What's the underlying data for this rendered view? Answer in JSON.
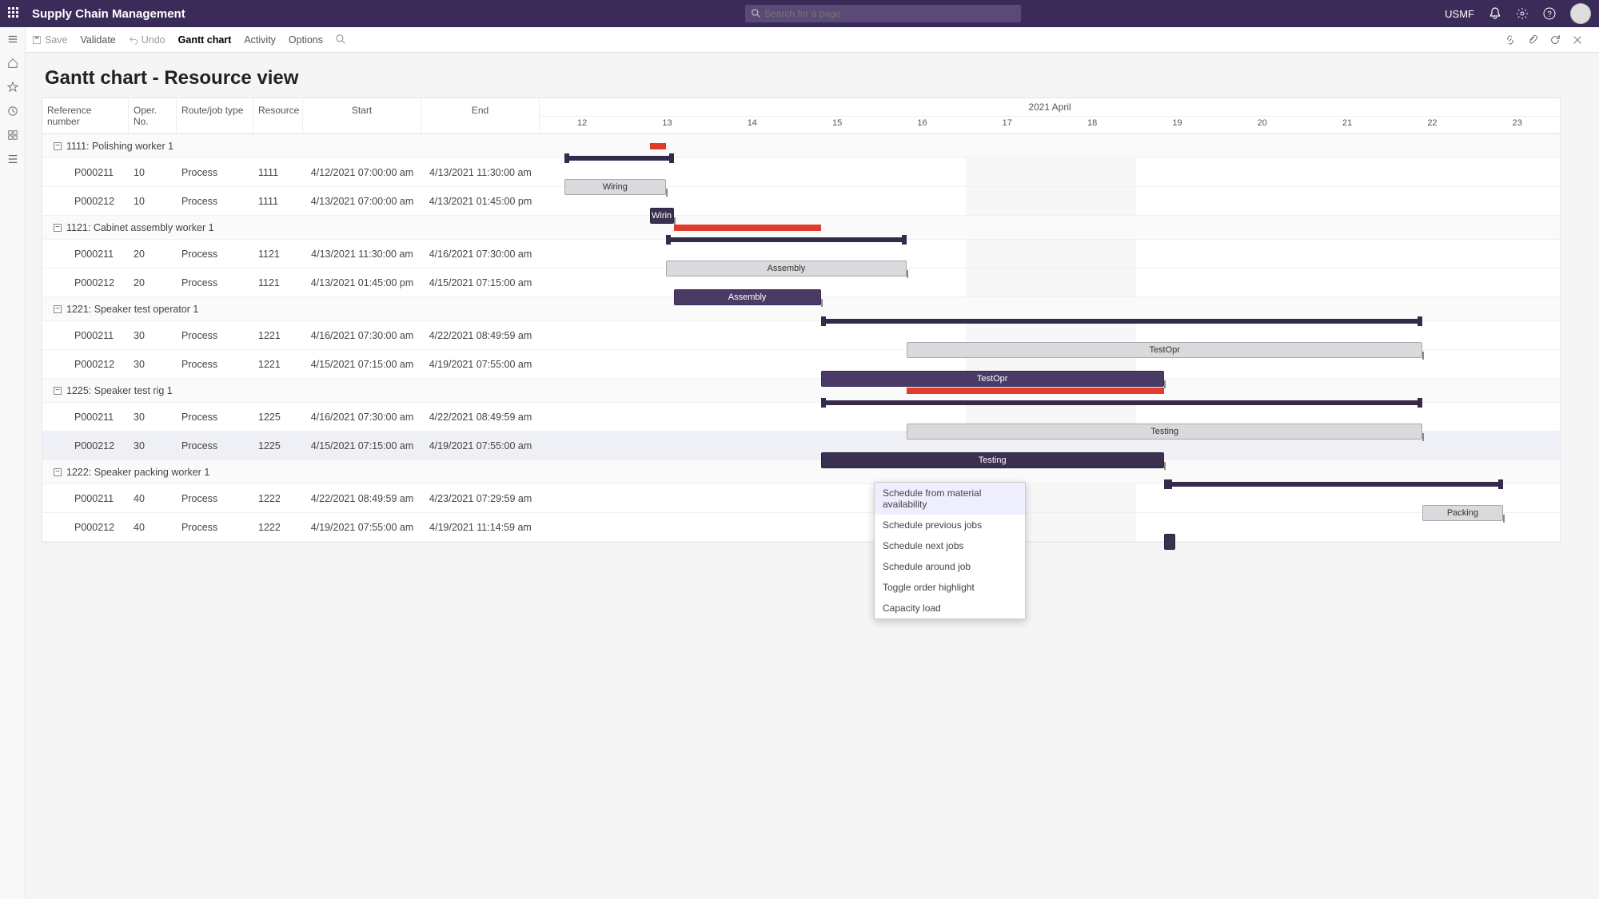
{
  "header": {
    "app_title": "Supply Chain Management",
    "search_placeholder": "Search for a page",
    "company": "USMF"
  },
  "actionbar": {
    "save": "Save",
    "validate": "Validate",
    "undo": "Undo",
    "tab_gantt": "Gantt chart",
    "tab_activity": "Activity",
    "tab_options": "Options"
  },
  "page_title": "Gantt chart - Resource view",
  "columns": {
    "ref": "Reference number",
    "op": "Oper. No.",
    "type": "Route/job type",
    "res": "Resource",
    "start": "Start",
    "end": "End"
  },
  "timeline": {
    "month": "2021 April",
    "days": [
      "12",
      "13",
      "14",
      "15",
      "16",
      "17",
      "18",
      "19",
      "20",
      "21",
      "22",
      "23"
    ]
  },
  "groups": [
    {
      "id": "g1",
      "label": "1111: Polishing worker 1"
    },
    {
      "id": "g2",
      "label": "1121: Cabinet assembly worker 1"
    },
    {
      "id": "g3",
      "label": "1221: Speaker test operator 1"
    },
    {
      "id": "g4",
      "label": "1225: Speaker test rig 1"
    },
    {
      "id": "g5",
      "label": "1222: Speaker packing worker 1"
    }
  ],
  "rows": [
    {
      "grp": 0,
      "ref": "P000211",
      "op": "10",
      "type": "Process",
      "res": "1111",
      "start": "4/12/2021 07:00:00 am",
      "end": "4/13/2021 11:30:00 am"
    },
    {
      "grp": 0,
      "ref": "P000212",
      "op": "10",
      "type": "Process",
      "res": "1111",
      "start": "4/13/2021 07:00:00 am",
      "end": "4/13/2021 01:45:00 pm"
    },
    {
      "grp": 1,
      "ref": "P000211",
      "op": "20",
      "type": "Process",
      "res": "1121",
      "start": "4/13/2021 11:30:00 am",
      "end": "4/16/2021 07:30:00 am"
    },
    {
      "grp": 1,
      "ref": "P000212",
      "op": "20",
      "type": "Process",
      "res": "1121",
      "start": "4/13/2021 01:45:00 pm",
      "end": "4/15/2021 07:15:00 am"
    },
    {
      "grp": 2,
      "ref": "P000211",
      "op": "30",
      "type": "Process",
      "res": "1221",
      "start": "4/16/2021 07:30:00 am",
      "end": "4/22/2021 08:49:59 am"
    },
    {
      "grp": 2,
      "ref": "P000212",
      "op": "30",
      "type": "Process",
      "res": "1221",
      "start": "4/15/2021 07:15:00 am",
      "end": "4/19/2021 07:55:00 am"
    },
    {
      "grp": 3,
      "ref": "P000211",
      "op": "30",
      "type": "Process",
      "res": "1225",
      "start": "4/16/2021 07:30:00 am",
      "end": "4/22/2021 08:49:59 am"
    },
    {
      "grp": 3,
      "ref": "P000212",
      "op": "30",
      "type": "Process",
      "res": "1225",
      "start": "4/15/2021 07:15:00 am",
      "end": "4/19/2021 07:55:00 am",
      "sel": true
    },
    {
      "grp": 4,
      "ref": "P000211",
      "op": "40",
      "type": "Process",
      "res": "1222",
      "start": "4/22/2021 08:49:59 am",
      "end": "4/23/2021 07:29:59 am"
    },
    {
      "grp": 4,
      "ref": "P000212",
      "op": "40",
      "type": "Process",
      "res": "1222",
      "start": "4/19/2021 07:55:00 am",
      "end": "4/19/2021 11:14:59 am"
    }
  ],
  "bars": {
    "wiring1": "Wiring",
    "wiring2": "Wirin",
    "assembly1": "Assembly",
    "assembly2": "Assembly",
    "testopr1": "TestOpr",
    "testopr2": "TestOpr",
    "testing1": "Testing",
    "testing2": "Testing",
    "packing": "Packing"
  },
  "context_menu": {
    "items": [
      "Schedule from material availability",
      "Schedule previous jobs",
      "Schedule next jobs",
      "Schedule around job",
      "Toggle order highlight",
      "Capacity load"
    ]
  },
  "chart_data": {
    "type": "gantt",
    "x_axis": {
      "unit": "day",
      "start": "2021-04-12",
      "end": "2021-04-23"
    },
    "resources": [
      {
        "id": "1111",
        "name": "Polishing worker 1"
      },
      {
        "id": "1121",
        "name": "Cabinet assembly worker 1"
      },
      {
        "id": "1221",
        "name": "Speaker test operator 1"
      },
      {
        "id": "1225",
        "name": "Speaker test rig 1"
      },
      {
        "id": "1222",
        "name": "Speaker packing worker 1"
      }
    ],
    "tasks": [
      {
        "ref": "P000211",
        "op": 10,
        "res": "1111",
        "label": "Wiring",
        "start": "2021-04-12T07:00",
        "end": "2021-04-13T11:30",
        "style": "light"
      },
      {
        "ref": "P000212",
        "op": 10,
        "res": "1111",
        "label": "Wiring",
        "start": "2021-04-13T07:00",
        "end": "2021-04-13T13:45",
        "style": "dark"
      },
      {
        "ref": "P000211",
        "op": 20,
        "res": "1121",
        "label": "Assembly",
        "start": "2021-04-13T11:30",
        "end": "2021-04-16T07:30",
        "style": "light"
      },
      {
        "ref": "P000212",
        "op": 20,
        "res": "1121",
        "label": "Assembly",
        "start": "2021-04-13T13:45",
        "end": "2021-04-15T07:15",
        "style": "dark"
      },
      {
        "ref": "P000211",
        "op": 30,
        "res": "1221",
        "label": "TestOpr",
        "start": "2021-04-16T07:30",
        "end": "2021-04-22T08:50",
        "style": "light"
      },
      {
        "ref": "P000212",
        "op": 30,
        "res": "1221",
        "label": "TestOpr",
        "start": "2021-04-15T07:15",
        "end": "2021-04-19T07:55",
        "style": "dark"
      },
      {
        "ref": "P000211",
        "op": 30,
        "res": "1225",
        "label": "Testing",
        "start": "2021-04-16T07:30",
        "end": "2021-04-22T08:50",
        "style": "light"
      },
      {
        "ref": "P000212",
        "op": 30,
        "res": "1225",
        "label": "Testing",
        "start": "2021-04-15T07:15",
        "end": "2021-04-19T07:55",
        "style": "dark",
        "selected": true
      },
      {
        "ref": "P000211",
        "op": 40,
        "res": "1222",
        "label": "Packing",
        "start": "2021-04-22T08:50",
        "end": "2021-04-23T07:30",
        "style": "light"
      },
      {
        "ref": "P000212",
        "op": 40,
        "res": "1222",
        "label": "Packing",
        "start": "2021-04-19T07:55",
        "end": "2021-04-19T11:15",
        "style": "dark"
      }
    ],
    "overload_segments": [
      {
        "res": "1111",
        "start": "2021-04-13T07:00",
        "end": "2021-04-13T11:30"
      },
      {
        "res": "1121",
        "start": "2021-04-13T13:45",
        "end": "2021-04-15T07:15"
      },
      {
        "res": "1225",
        "start": "2021-04-16T07:30",
        "end": "2021-04-19T07:55"
      }
    ]
  }
}
